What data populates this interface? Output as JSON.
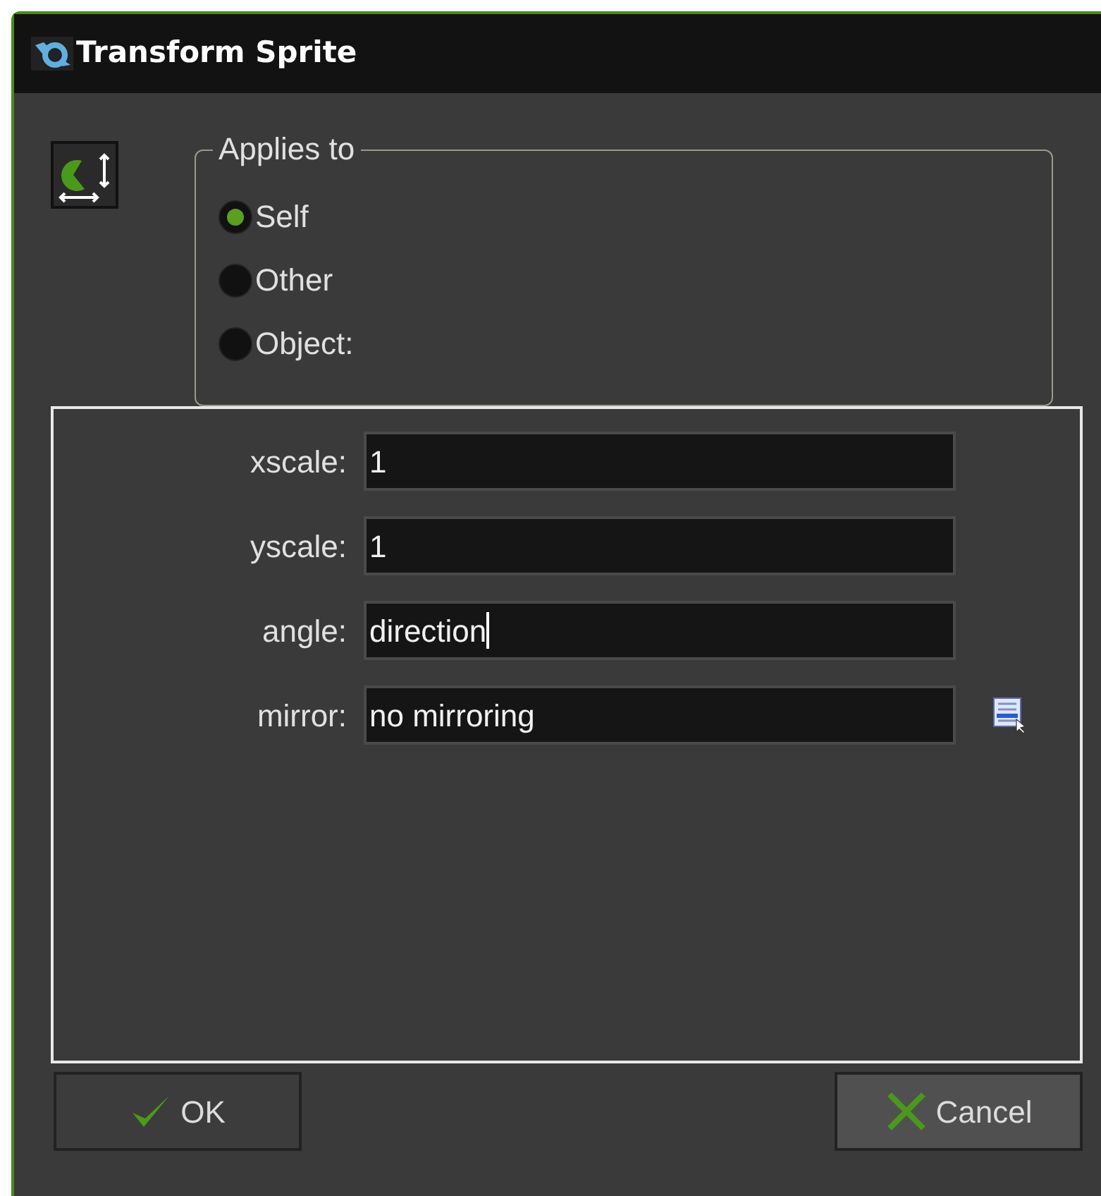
{
  "window": {
    "title": "Transform Sprite"
  },
  "applies_to": {
    "legend": "Applies to",
    "options": [
      {
        "label": "Self",
        "selected": true
      },
      {
        "label": "Other",
        "selected": false
      },
      {
        "label": "Object:",
        "selected": false
      }
    ]
  },
  "fields": [
    {
      "label": "xscale:",
      "value": "1",
      "focused": false,
      "menu": false
    },
    {
      "label": "yscale:",
      "value": "1",
      "focused": false,
      "menu": false
    },
    {
      "label": "angle:",
      "value": "direction",
      "focused": true,
      "menu": false
    },
    {
      "label": "mirror:",
      "value": "no mirroring",
      "focused": false,
      "menu": true
    }
  ],
  "buttons": [
    {
      "label": "OK",
      "kind": "ok"
    },
    {
      "label": "Cancel",
      "kind": "cancel"
    }
  ]
}
